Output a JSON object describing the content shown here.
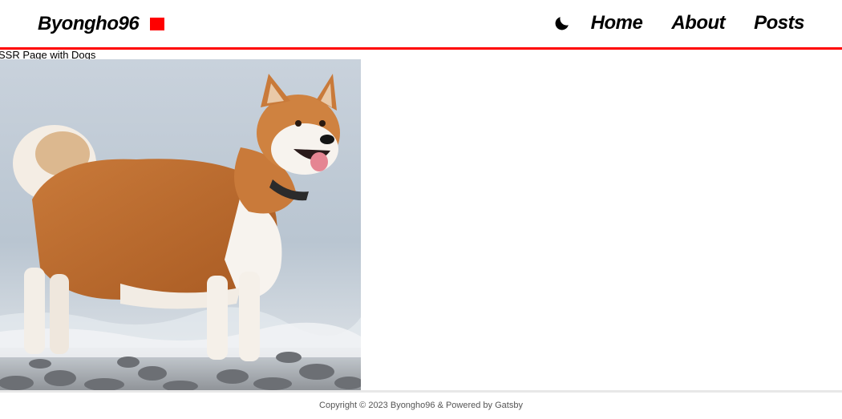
{
  "header": {
    "brand": "Byongho96",
    "brand_accent_color": "#ff0000",
    "theme_toggle_icon": "moon-icon",
    "nav": [
      {
        "label": "Home"
      },
      {
        "label": "About"
      },
      {
        "label": "Posts"
      }
    ]
  },
  "main": {
    "page_text": "SSR Page with Dogs",
    "image_subject": "akita-dog-photo"
  },
  "footer": {
    "text": "Copyright © 2023 Byongho96 & Powered by Gatsby"
  }
}
